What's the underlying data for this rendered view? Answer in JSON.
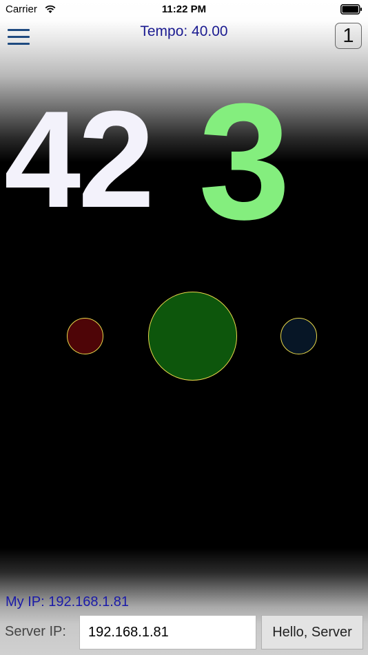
{
  "status_bar": {
    "carrier": "Carrier",
    "time": "11:22 PM",
    "wifi_icon": "wifi-icon",
    "battery_icon": "battery-icon"
  },
  "header": {
    "menu_icon": "hamburger-menu-icon",
    "tempo": "Tempo: 40.00",
    "beat_badge": "1"
  },
  "counter": {
    "measure": "42",
    "beat": "3",
    "measure_color": "#f3f2fb",
    "beat_color": "#84ee7e"
  },
  "lights": [
    {
      "name": "left",
      "color": "#4e0507"
    },
    {
      "name": "center",
      "color": "#0d560c"
    },
    {
      "name": "right",
      "color": "#071626"
    }
  ],
  "network": {
    "my_ip": "My IP: 192.168.1.81",
    "server_label": "Server IP:",
    "server_ip_value": "192.168.1.81",
    "hello_button": "Hello, Server"
  },
  "colors": {
    "tempo_text": "#1a1a90",
    "ip_text": "#1a1aa8",
    "light_border": "#e8d84a"
  }
}
